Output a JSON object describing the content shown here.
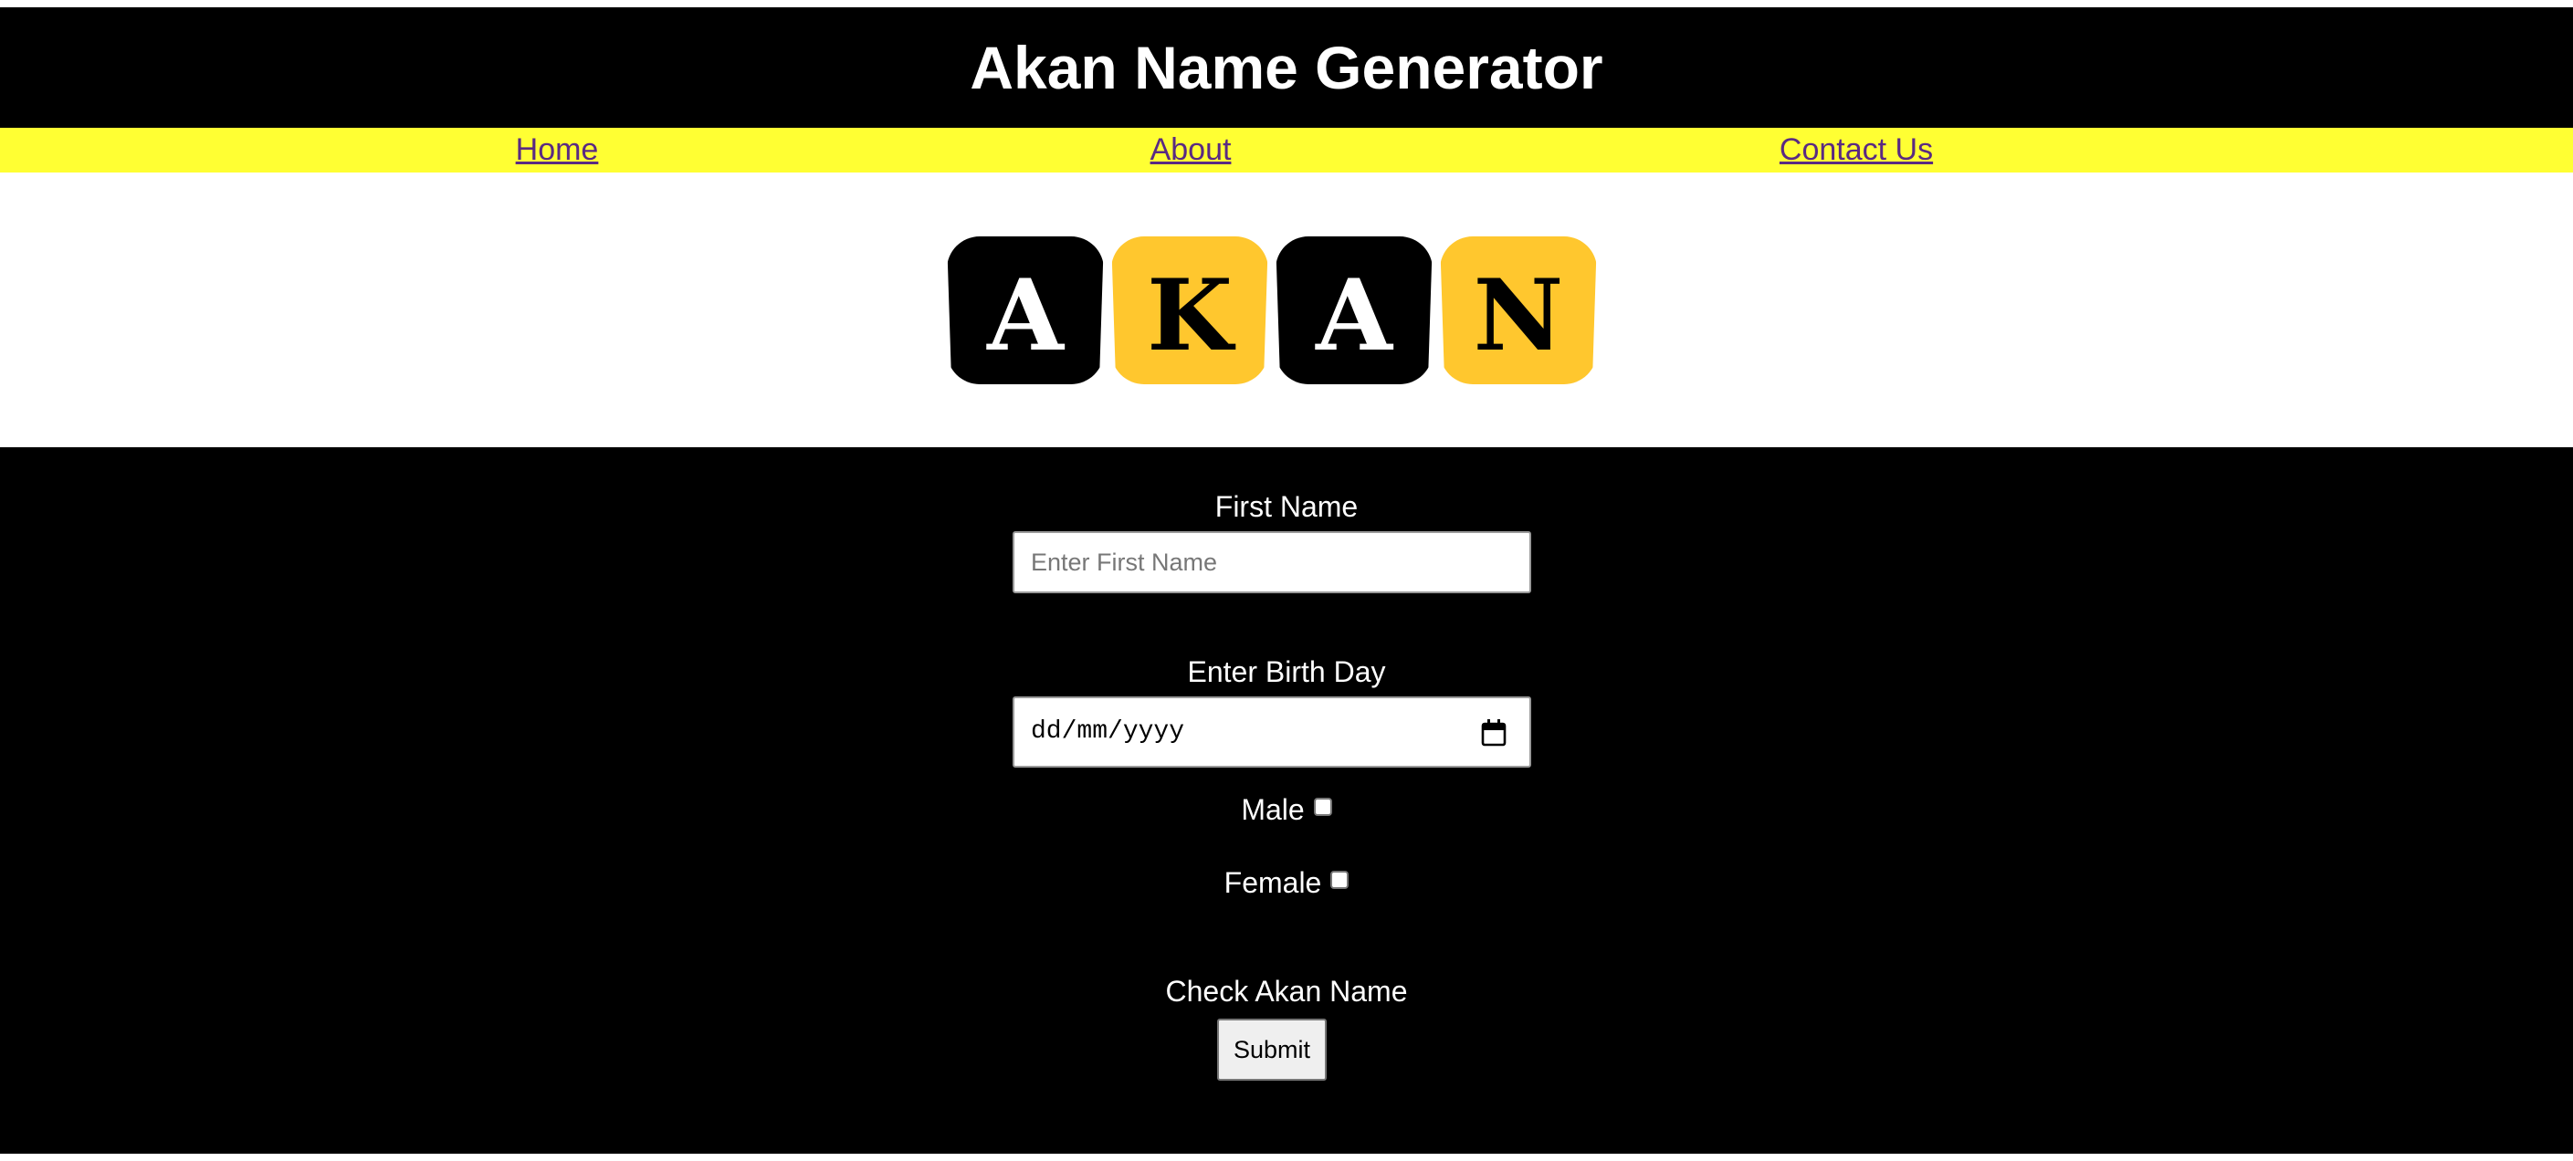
{
  "header": {
    "title": "Akan Name Generator"
  },
  "nav": {
    "items": [
      {
        "label": "Home"
      },
      {
        "label": "About"
      },
      {
        "label": "Contact Us"
      }
    ],
    "link_color": "#5a2a82",
    "background": "#ffff33"
  },
  "logo": {
    "letters": [
      "A",
      "K",
      "A",
      "N"
    ],
    "tile_colors": [
      "#000000",
      "#ffc72e",
      "#000000",
      "#ffc72e"
    ],
    "letter_colors": [
      "#ffffff",
      "#000000",
      "#ffffff",
      "#000000"
    ]
  },
  "form": {
    "first_name_label": "First Name",
    "first_name_placeholder": "Enter First Name",
    "first_name_value": "",
    "birthday_label": "Enter Birth Day",
    "birthday_placeholder": "dd/mm/yyyy",
    "calendar_icon": "calendar-icon",
    "male_label": "Male",
    "male_checked": false,
    "female_label": "Female",
    "female_checked": false,
    "check_label": "Check Akan Name",
    "submit_label": "Submit"
  }
}
